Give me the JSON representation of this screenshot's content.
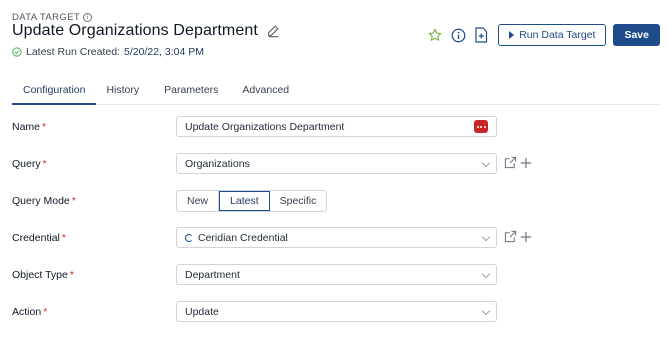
{
  "header": {
    "section_label": "DATA TARGET",
    "title": "Update Organizations Department",
    "last_run_label": "Latest Run Created:",
    "last_run_date": "5/20/22, 3:04 PM"
  },
  "actions": {
    "run_label": "Run Data Target",
    "save_label": "Save"
  },
  "tabs": [
    {
      "label": "Configuration",
      "active": true
    },
    {
      "label": "History",
      "active": false
    },
    {
      "label": "Parameters",
      "active": false
    },
    {
      "label": "Advanced",
      "active": false
    }
  ],
  "form": {
    "name": {
      "label": "Name",
      "value": "Update Organizations Department"
    },
    "query": {
      "label": "Query",
      "value": "Organizations"
    },
    "query_mode": {
      "label": "Query Mode",
      "options": [
        "New",
        "Latest",
        "Specific"
      ],
      "selected": "Latest"
    },
    "credential": {
      "label": "Credential",
      "value": "Ceridian Credential"
    },
    "object_type": {
      "label": "Object Type",
      "value": "Department"
    },
    "action": {
      "label": "Action",
      "value": "Update"
    }
  },
  "colors": {
    "primary": "#1e4b8a",
    "required": "#dc2626",
    "star": "#7cb342",
    "success": "#4caf50",
    "dots_button": "#c62828"
  },
  "icons": [
    "info-icon",
    "pencil-icon",
    "check-circle-icon",
    "star-icon",
    "info-circle-icon",
    "document-add-icon",
    "play-icon",
    "ellipsis-icon",
    "chevron-down-icon",
    "external-link-icon",
    "plus-icon",
    "loading-icon"
  ]
}
